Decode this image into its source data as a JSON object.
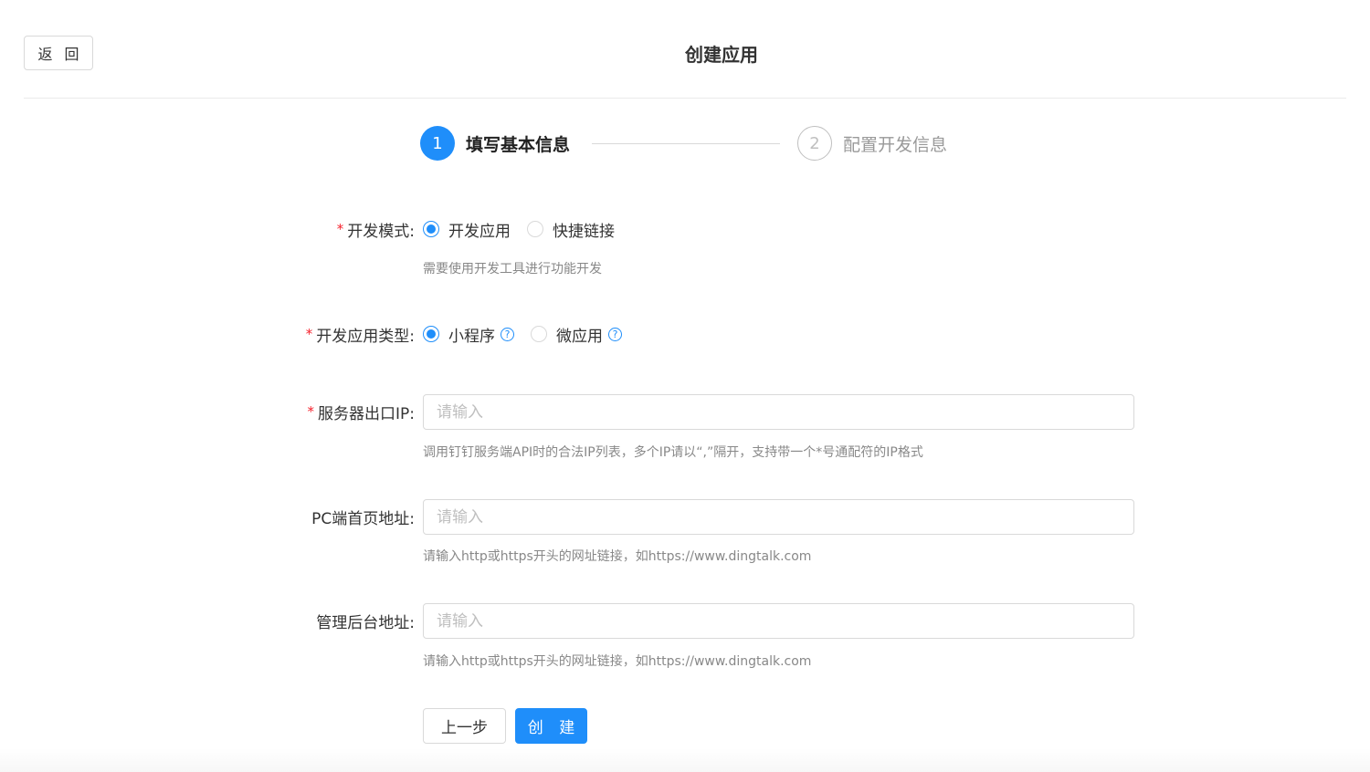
{
  "header": {
    "back_label": "返 回",
    "title": "创建应用"
  },
  "steps": [
    {
      "number": "1",
      "label": "填写基本信息",
      "active": true
    },
    {
      "number": "2",
      "label": "配置开发信息",
      "active": false
    }
  ],
  "form": {
    "dev_mode": {
      "label": "开发模式:",
      "required": "*",
      "options": [
        {
          "label": "开发应用",
          "checked": true
        },
        {
          "label": "快捷链接",
          "checked": false
        }
      ],
      "hint": "需要使用开发工具进行功能开发"
    },
    "app_type": {
      "label": "开发应用类型:",
      "required": "*",
      "options": [
        {
          "label": "小程序",
          "checked": true,
          "help": "?"
        },
        {
          "label": "微应用",
          "checked": false,
          "help": "?"
        }
      ]
    },
    "server_ip": {
      "label": "服务器出口IP:",
      "required": "*",
      "placeholder": "请输入",
      "value": "",
      "hint": "调用钉钉服务端API时的合法IP列表，多个IP请以“,”隔开，支持带一个*号通配符的IP格式"
    },
    "pc_url": {
      "label": "PC端首页地址:",
      "placeholder": "请输入",
      "value": "",
      "hint": "请输入http或https开头的网址链接，如https://www.dingtalk.com"
    },
    "admin_url": {
      "label": "管理后台地址:",
      "placeholder": "请输入",
      "value": "",
      "hint": "请输入http或https开头的网址链接，如https://www.dingtalk.com"
    }
  },
  "actions": {
    "prev_label": "上一步",
    "create_label": "创 建"
  },
  "colors": {
    "primary": "#1f8efa",
    "required": "#f5222d"
  }
}
